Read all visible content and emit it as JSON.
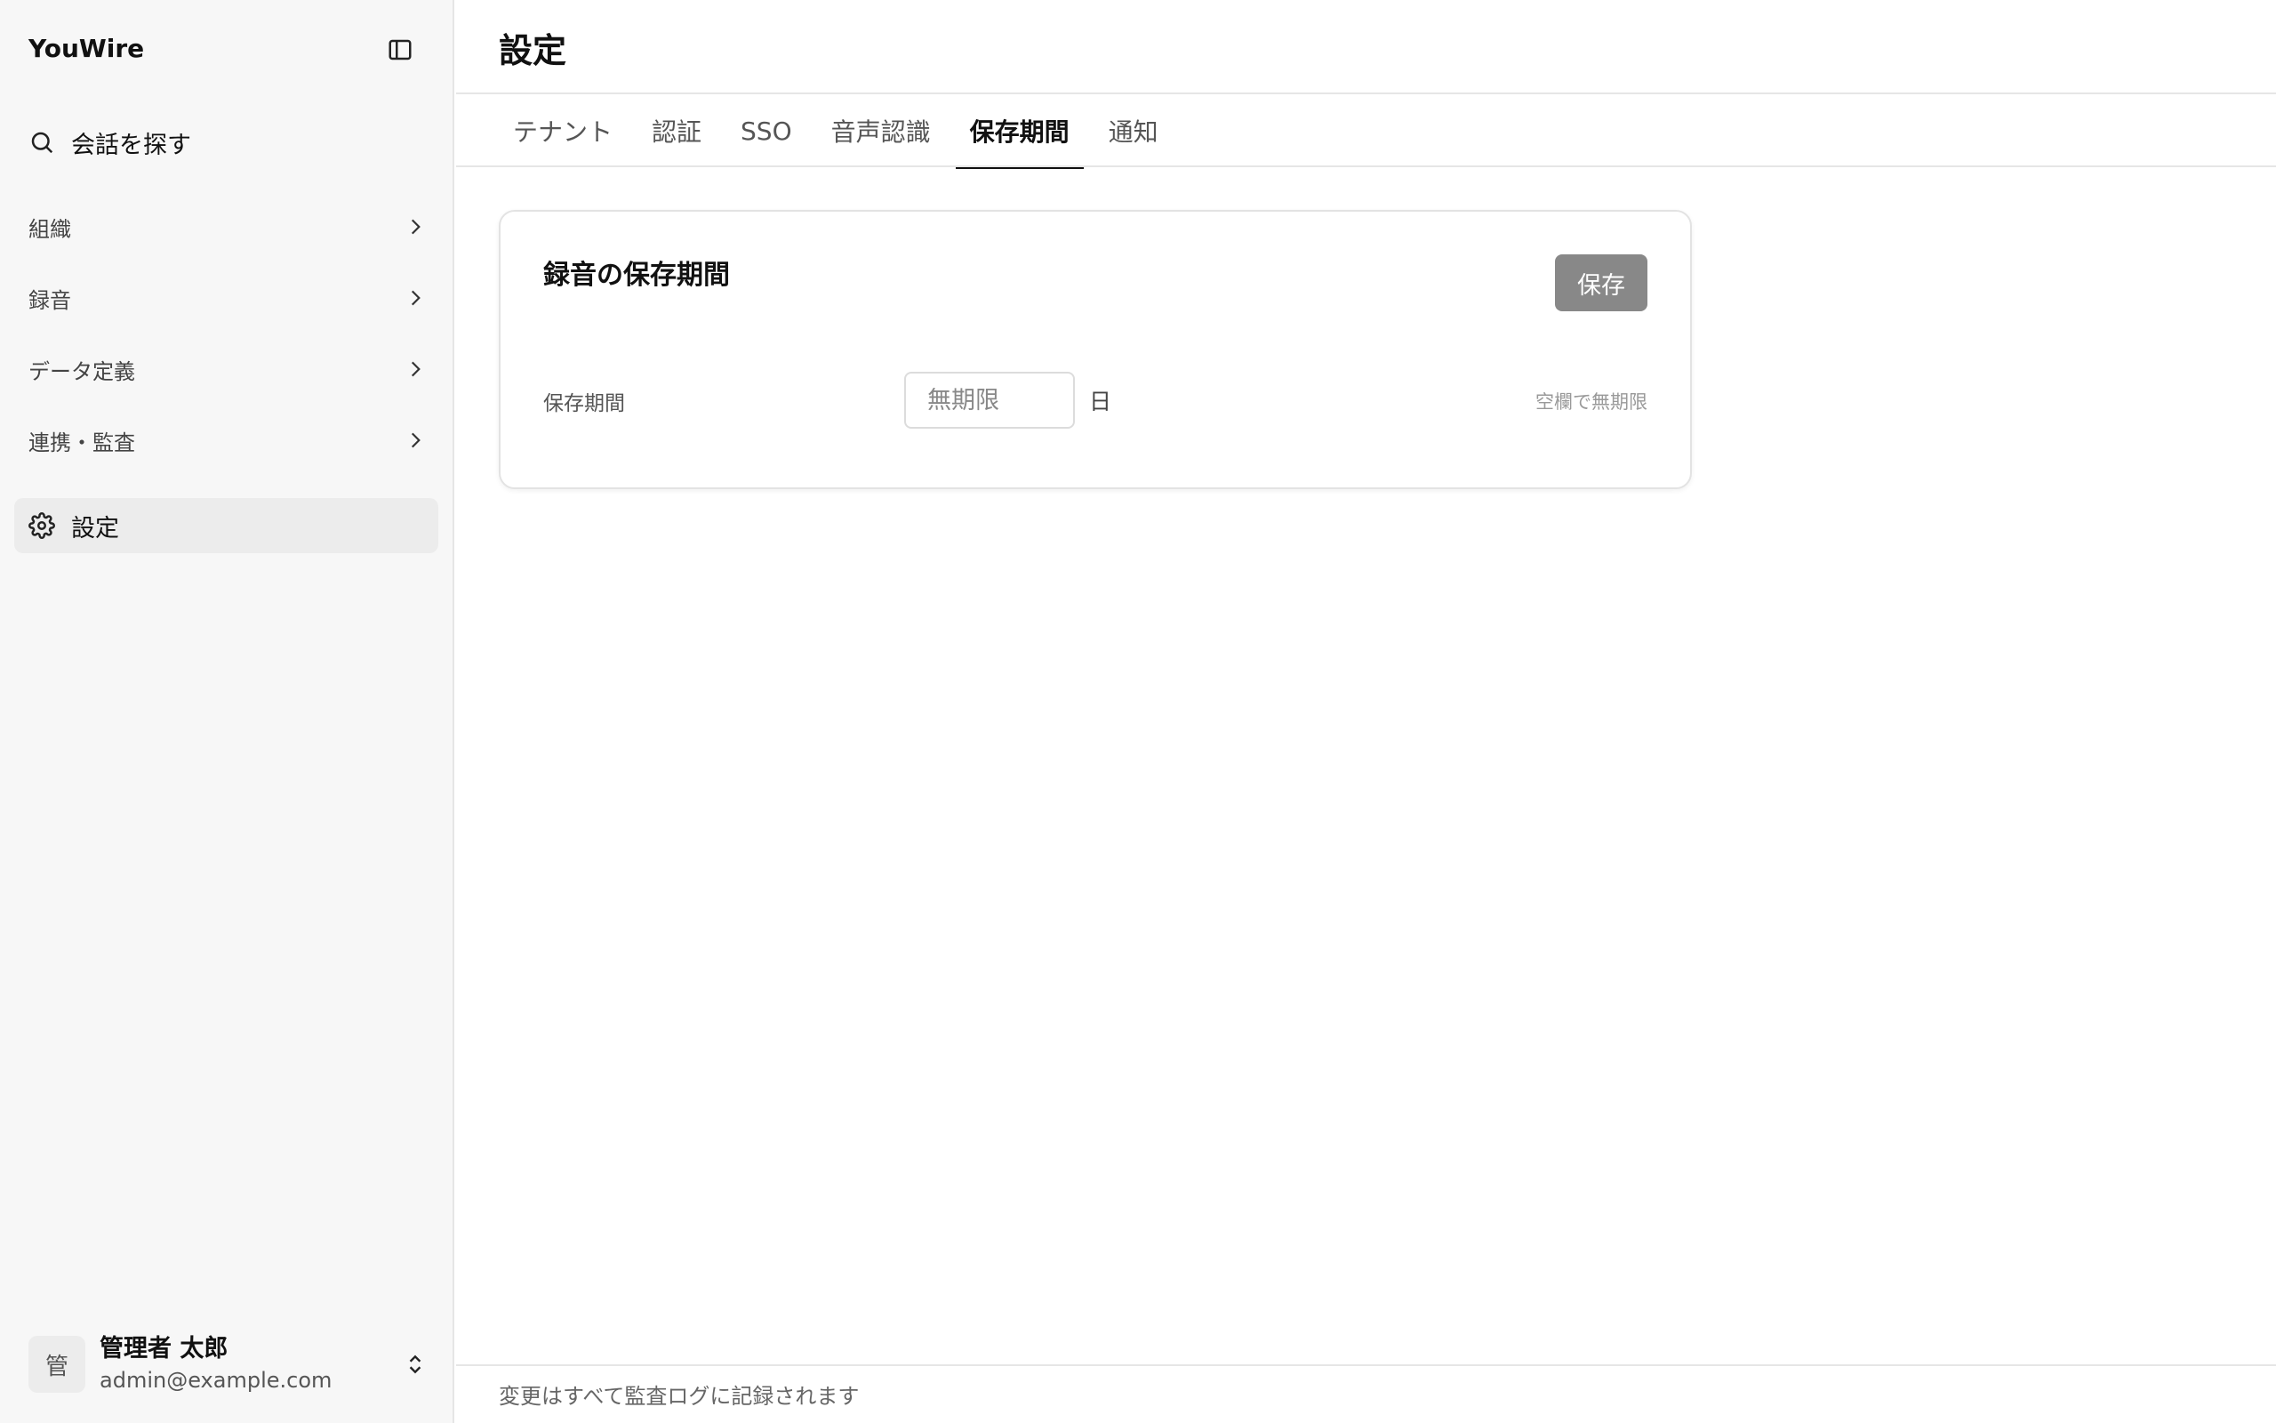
{
  "app": {
    "brand": "YouWire"
  },
  "sidebar": {
    "search_label": "会話を探す",
    "items": [
      {
        "label": "組織"
      },
      {
        "label": "録音"
      },
      {
        "label": "データ定義"
      },
      {
        "label": "連携・監査"
      }
    ],
    "settings_label": "設定",
    "user": {
      "avatar_initial": "管",
      "name": "管理者 太郎",
      "email": "admin@example.com"
    }
  },
  "header": {
    "title": "設定"
  },
  "tabs": [
    {
      "label": "テナント"
    },
    {
      "label": "認証"
    },
    {
      "label": "SSO"
    },
    {
      "label": "音声認識"
    },
    {
      "label": "保存期間",
      "active": true
    },
    {
      "label": "通知"
    }
  ],
  "card": {
    "title": "録音の保存期間",
    "save_label": "保存",
    "field_label": "保存期間",
    "field_value": "",
    "field_placeholder": "無期限",
    "unit": "日",
    "hint": "空欄で無期限"
  },
  "footer": {
    "text": "変更はすべて監査ログに記録されます"
  },
  "colors": {
    "save_button_bg": "#888888",
    "active_tab_underline": "#111111",
    "sidebar_bg": "#f7f7f7"
  },
  "icons": {
    "toggle": "sidebar-toggle-icon",
    "search": "search-icon",
    "chevron": "chevron-right-icon",
    "settings": "gear-icon",
    "user_menu": "chevron-up-down-icon"
  }
}
